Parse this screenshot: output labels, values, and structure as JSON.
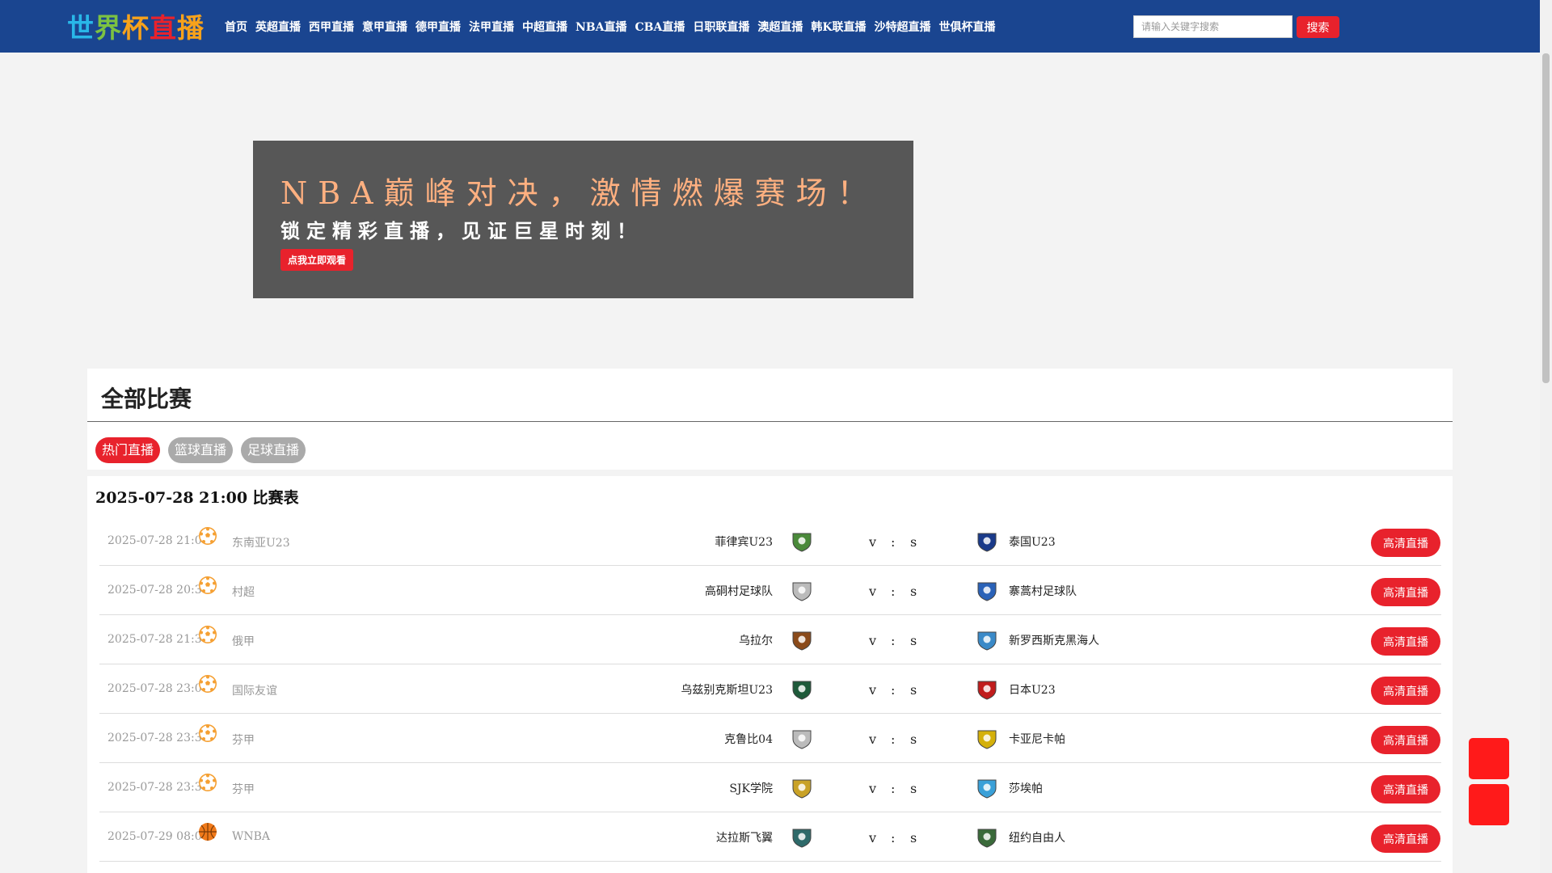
{
  "header": {
    "logo_text": "世界杯直播",
    "nav": [
      "首页",
      "英超直播",
      "西甲直播",
      "意甲直播",
      "德甲直播",
      "法甲直播",
      "中超直播",
      "NBA直播",
      "CBA直播",
      "日职联直播",
      "澳超直播",
      "韩K联直播",
      "沙特超直播",
      "世俱杯直播"
    ],
    "search_placeholder": "请输入关键字搜索",
    "search_button": "搜索"
  },
  "banner": {
    "headline": "NBA巅峰对决，激情燃爆赛场！",
    "subline": "锁定精彩直播，见证巨星时刻！",
    "button": "点我立即观看"
  },
  "main": {
    "title": "全部比赛",
    "tabs": [
      {
        "label": "热门直播",
        "active": true
      },
      {
        "label": "篮球直播",
        "active": false
      },
      {
        "label": "足球直播",
        "active": false
      }
    ],
    "schedule_title": "2025-07-28 21:00 比赛表",
    "matches": [
      {
        "time": "2025-07-28 21:00",
        "sport": "football-icon",
        "league": "东南亚U23",
        "home": "菲律宾U23",
        "v": "v",
        "colon": ":",
        "s": "s",
        "away": "泰国U23",
        "button": "高清直播"
      },
      {
        "time": "2025-07-28 20:30",
        "sport": "football-icon",
        "league": "村超",
        "home": "高硐村足球队",
        "v": "v",
        "colon": ":",
        "s": "s",
        "away": "寨蒿村足球队",
        "button": "高清直播"
      },
      {
        "time": "2025-07-28 21:30",
        "sport": "football-icon",
        "league": "俄甲",
        "home": "乌拉尔",
        "v": "v",
        "colon": ":",
        "s": "s",
        "away": "新罗西斯克黑海人",
        "button": "高清直播"
      },
      {
        "time": "2025-07-28 23:00",
        "sport": "football-icon",
        "league": "国际友谊",
        "home": "乌兹别克斯坦U23",
        "v": "v",
        "colon": ":",
        "s": "s",
        "away": "日本U23",
        "button": "高清直播"
      },
      {
        "time": "2025-07-28 23:30",
        "sport": "football-icon",
        "league": "芬甲",
        "home": "克鲁比04",
        "v": "v",
        "colon": ":",
        "s": "s",
        "away": "卡亚尼卡帕",
        "button": "高清直播"
      },
      {
        "time": "2025-07-28 23:30",
        "sport": "football-icon",
        "league": "芬甲",
        "home": "SJK学院",
        "v": "v",
        "colon": ":",
        "s": "s",
        "away": "莎埃帕",
        "button": "高清直播"
      },
      {
        "time": "2025-07-29 08:00",
        "sport": "basketball-icon",
        "league": "WNBA",
        "home": "达拉斯飞翼",
        "v": "v",
        "colon": ":",
        "s": "s",
        "away": "纽约自由人",
        "button": "高清直播"
      }
    ]
  },
  "colors": {
    "header_bg": "#1a4590",
    "accent_red": "#e8222c",
    "float_red": "#ff1a1a",
    "banner_bg": "#575757"
  }
}
